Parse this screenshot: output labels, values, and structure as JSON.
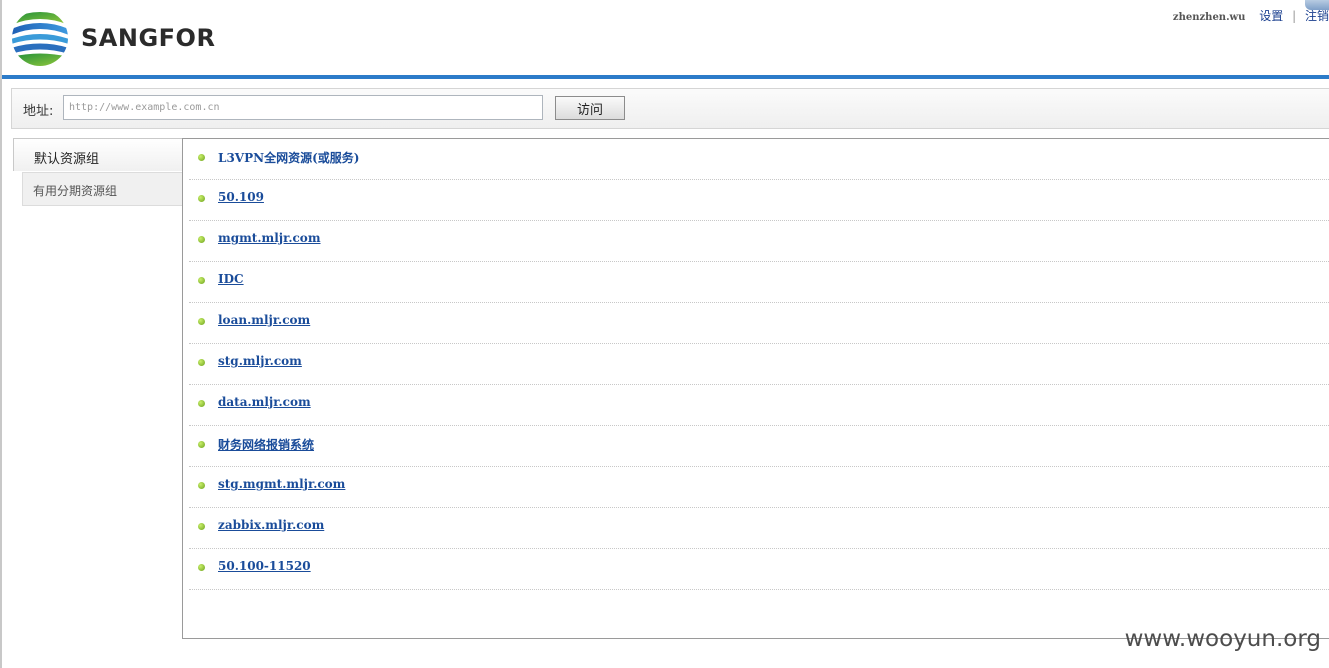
{
  "header": {
    "brand": "SANGFOR",
    "username": "zhenzhen.wu",
    "settings_link": "设置",
    "separator": "|",
    "logout_link": "注销"
  },
  "addressbar": {
    "label": "地址:",
    "placeholder": "http://www.example.com.cn",
    "visit_button": "访问"
  },
  "groups": [
    {
      "label": "默认资源组",
      "active": true
    },
    {
      "label": "有用分期资源组",
      "active": false
    }
  ],
  "resources": [
    {
      "label": "L3VPN全网资源(或服务)"
    },
    {
      "label": "50.109"
    },
    {
      "label": "mgmt.mljr.com"
    },
    {
      "label": "IDC"
    },
    {
      "label": "loan.mljr.com"
    },
    {
      "label": "stg.mljr.com"
    },
    {
      "label": "data.mljr.com"
    },
    {
      "label": "财务网络报销系统"
    },
    {
      "label": "stg.mgmt.mljr.com"
    },
    {
      "label": "zabbix.mljr.com"
    },
    {
      "label": "50.100-11520"
    }
  ],
  "watermark": "www.wooyun.org",
  "colors": {
    "accent_blue": "#2c7bc9",
    "link_blue": "#1a4c9a",
    "bullet_green": "#7fbf2a"
  },
  "icons": {
    "logo": "sangfor-globe-logo",
    "bullet": "green-dot-bullet-icon"
  }
}
